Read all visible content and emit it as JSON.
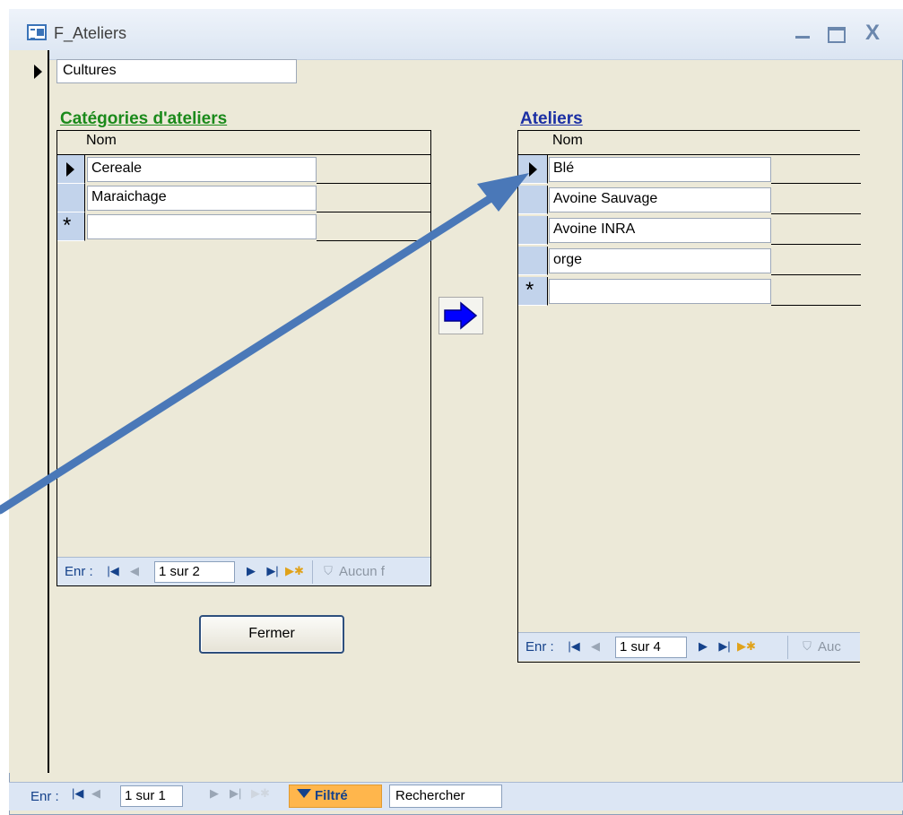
{
  "window": {
    "title": "F_Ateliers",
    "buttons": {
      "minimize": "_",
      "maximize": "□",
      "close": "X"
    }
  },
  "main_field": {
    "value": "Cultures"
  },
  "categories_panel": {
    "title": "Catégories d'ateliers",
    "column_header": "Nom",
    "rows": [
      {
        "value": "Cereale",
        "current": true
      },
      {
        "value": "Maraichage",
        "current": false
      }
    ],
    "new_row_marker": "*",
    "navigation": {
      "label": "Enr :",
      "record": "1 sur 2",
      "filter_text": "Aucun f"
    }
  },
  "ateliers_panel": {
    "title": "Ateliers",
    "column_header": "Nom",
    "rows": [
      {
        "value": "Blé",
        "current": true
      },
      {
        "value": "Avoine Sauvage",
        "current": false
      },
      {
        "value": "Avoine INRA",
        "current": false
      },
      {
        "value": "orge",
        "current": false
      }
    ],
    "new_row_marker": "*",
    "navigation": {
      "label": "Enr :",
      "record": "1 sur 4",
      "filter_text": "Auc"
    }
  },
  "close_button": {
    "label": "Fermer"
  },
  "main_navigation": {
    "label": "Enr :",
    "record": "1 sur 1",
    "filter_status": "Filtré",
    "search_label": "Rechercher"
  },
  "icons": {
    "first": "⏮",
    "previous": "◀",
    "next": "▶",
    "last": "⏭",
    "new": "▶*"
  },
  "colors": {
    "categories_title": "#1b8a1b",
    "ateliers_title": "#1b2fa4",
    "arrow_button": "#0000ff",
    "annotation_arrow": "#4a78b8",
    "filtered_badge": "#ffb64c"
  }
}
